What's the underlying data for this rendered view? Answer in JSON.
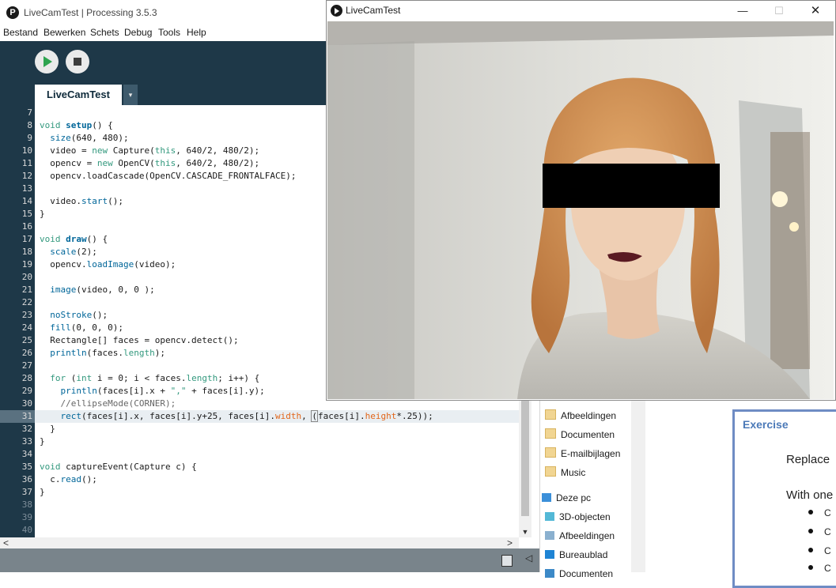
{
  "processing_window": {
    "title": "LiveCamTest | Processing 3.5.3",
    "logo_glyph": "P",
    "menu": [
      "Bestand",
      "Bewerken",
      "Schets",
      "Debug",
      "Tools",
      "Help"
    ],
    "tab_name": "LiveCamTest",
    "tab_menu_glyph": "▾",
    "run_icon": "play-icon",
    "stop_icon": "stop-icon",
    "active_line": 31
  },
  "code_lines": [
    {
      "n": 7,
      "html": ""
    },
    {
      "n": 8,
      "html": "<span class=\"k\">void</span> <span class=\"f\">setup</span>() {"
    },
    {
      "n": 9,
      "html": "  <span class=\"fn\">size</span>(640, 480);"
    },
    {
      "n": 10,
      "html": "  video = <span class=\"k\">new</span> Capture(<span class=\"k\">this</span>, 640/2, 480/2);"
    },
    {
      "n": 11,
      "html": "  opencv = <span class=\"k\">new</span> OpenCV(<span class=\"k\">this</span>, 640/2, 480/2);"
    },
    {
      "n": 12,
      "html": "  opencv.loadCascade(OpenCV.CASCADE_FRONTALFACE);"
    },
    {
      "n": 13,
      "html": ""
    },
    {
      "n": 14,
      "html": "  video.<span class=\"fn\">start</span>();"
    },
    {
      "n": 15,
      "html": "}"
    },
    {
      "n": 16,
      "html": ""
    },
    {
      "n": 17,
      "html": "<span class=\"k\">void</span> <span class=\"f\">draw</span>() {"
    },
    {
      "n": 18,
      "html": "  <span class=\"fn\">scale</span>(2);"
    },
    {
      "n": 19,
      "html": "  opencv.<span class=\"fn\">loadImage</span>(video);"
    },
    {
      "n": 20,
      "html": ""
    },
    {
      "n": 21,
      "html": "  <span class=\"fn\">image</span>(video, 0, 0 );"
    },
    {
      "n": 22,
      "html": ""
    },
    {
      "n": 23,
      "html": "  <span class=\"fn\">noStroke</span>();"
    },
    {
      "n": 24,
      "html": "  <span class=\"fn\">fill</span>(0, 0, 0);"
    },
    {
      "n": 25,
      "html": "  Rectangle[] faces = opencv.detect();"
    },
    {
      "n": 26,
      "html": "  <span class=\"fn\">println</span>(faces.<span class=\"k\">length</span>);"
    },
    {
      "n": 27,
      "html": ""
    },
    {
      "n": 28,
      "html": "  <span class=\"k\">for</span> (<span class=\"k\">int</span> i = 0; i &lt; faces.<span class=\"k\">length</span>; i++) {"
    },
    {
      "n": 29,
      "html": "    <span class=\"fn\">println</span>(faces[i].x + <span class=\"k\">\",\"</span> + faces[i].y);"
    },
    {
      "n": 30,
      "html": "    <span class=\"c\">//ellipseMode(CORNER);</span>"
    },
    {
      "n": 31,
      "html": "    <span class=\"fn\">rect</span>(faces[i].x, faces[i].y+25, faces[i].<span class=\"t\">width</span>, <span class=\"bracket\">(</span><span class=\"cursor\"></span>faces[i].<span class=\"t\">height</span>*.25));"
    },
    {
      "n": 32,
      "html": "  }"
    },
    {
      "n": 33,
      "html": "}"
    },
    {
      "n": 34,
      "html": ""
    },
    {
      "n": 35,
      "html": "<span class=\"k\">void</span> captureEvent(Capture c) {"
    },
    {
      "n": 36,
      "html": "  c.<span class=\"fn\">read</span>();"
    },
    {
      "n": 37,
      "html": "}"
    },
    {
      "n": 38,
      "html": ""
    },
    {
      "n": 39,
      "html": ""
    },
    {
      "n": 40,
      "html": ""
    }
  ],
  "cam_window": {
    "title": "LiveCamTest",
    "minimize_glyph": "—",
    "maximize_glyph": "☐",
    "close_glyph": "✕"
  },
  "explorer": {
    "items": [
      {
        "label": "Afbeeldingen",
        "icon": "folder-icon"
      },
      {
        "label": "Documenten",
        "icon": "folder-icon"
      },
      {
        "label": "E-mailbijlagen",
        "icon": "folder-icon"
      },
      {
        "label": "Music",
        "icon": "folder-icon"
      },
      {
        "label": "Deze pc",
        "icon": "pc-icon"
      },
      {
        "label": "3D-objecten",
        "icon": "cube-icon"
      },
      {
        "label": "Afbeeldingen",
        "icon": "pictures-icon"
      },
      {
        "label": "Bureaublad",
        "icon": "desktop-icon"
      },
      {
        "label": "Documenten",
        "icon": "documents-icon"
      }
    ]
  },
  "webpage": {
    "exercise_title": "Exercise",
    "text_1": "Replace",
    "text_2": "With one",
    "bullets": [
      "C",
      "C",
      "C",
      "C"
    ]
  },
  "colors": {
    "ide_dark": "#1e3848",
    "keyword": "#33997e",
    "function": "#006699",
    "status_bar": "#79848b",
    "exercise_border": "#6f8cc4"
  },
  "scrollbar_icons": {
    "up": "▲",
    "down": "▼",
    "left": "<",
    "right": ">"
  }
}
